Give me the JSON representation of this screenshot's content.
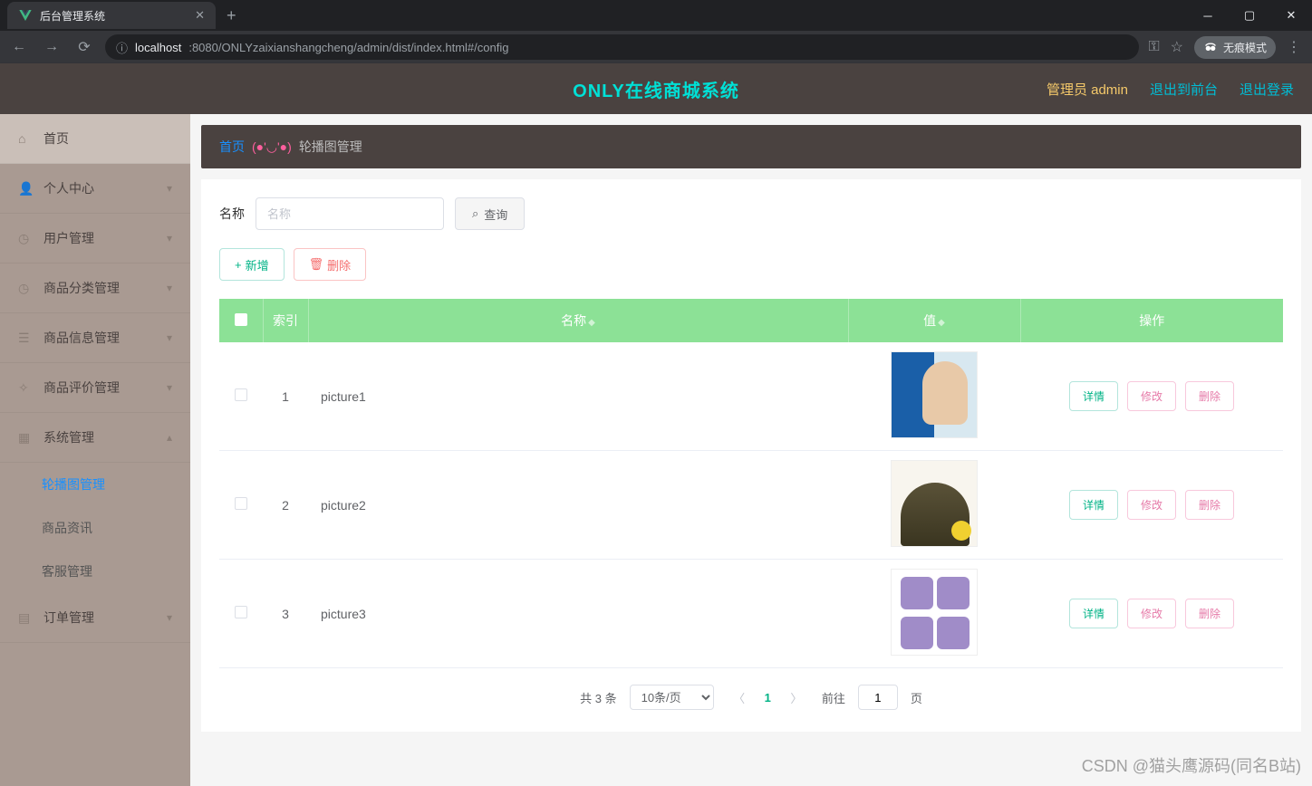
{
  "browser": {
    "tab_title": "后台管理系统",
    "url_host": "localhost",
    "url_path": ":8080/ONLYzaixianshangcheng/admin/dist/index.html#/config",
    "incognito_label": "无痕模式"
  },
  "header": {
    "app_title": "ONLY在线商城系统",
    "admin_label": "管理员 admin",
    "back_to_front": "退出到前台",
    "logout": "退出登录"
  },
  "sidebar": {
    "items": [
      {
        "label": "首页"
      },
      {
        "label": "个人中心"
      },
      {
        "label": "用户管理"
      },
      {
        "label": "商品分类管理"
      },
      {
        "label": "商品信息管理"
      },
      {
        "label": "商品评价管理"
      },
      {
        "label": "系统管理",
        "children": [
          {
            "label": "轮播图管理"
          },
          {
            "label": "商品资讯"
          },
          {
            "label": "客服管理"
          }
        ]
      },
      {
        "label": "订单管理"
      }
    ]
  },
  "breadcrumb": {
    "home": "首页",
    "emoji": "(●'◡'●)",
    "current": "轮播图管理"
  },
  "search": {
    "label": "名称",
    "placeholder": "名称",
    "button": "查询"
  },
  "actions": {
    "add": "新增",
    "delete": "删除"
  },
  "table": {
    "columns": {
      "index": "索引",
      "name": "名称",
      "value": "值",
      "ops": "操作"
    },
    "rows": [
      {
        "index": "1",
        "name": "picture1"
      },
      {
        "index": "2",
        "name": "picture2"
      },
      {
        "index": "3",
        "name": "picture3"
      }
    ],
    "row_ops": {
      "detail": "详情",
      "edit": "修改",
      "delete": "删除"
    }
  },
  "pager": {
    "total_label": "共 3 条",
    "page_size_label": "10条/页",
    "current_page": "1",
    "goto_prefix": "前往",
    "goto_suffix": "页",
    "goto_value": "1"
  },
  "watermark": "CSDN @猫头鹰源码(同名B站)"
}
